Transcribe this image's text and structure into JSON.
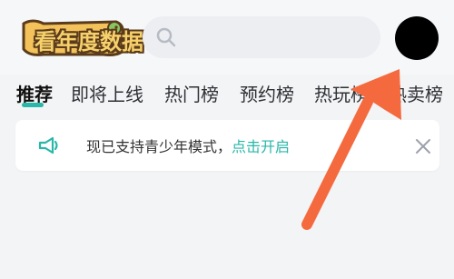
{
  "header": {
    "logo_text": "看年度数据",
    "search_icon": "search-icon",
    "avatar_icon": "avatar"
  },
  "tabs": [
    {
      "label": "推荐",
      "active": true
    },
    {
      "label": "即将上线",
      "active": false
    },
    {
      "label": "热门榜",
      "active": false
    },
    {
      "label": "预约榜",
      "active": false
    },
    {
      "label": "热玩榜",
      "active": false
    },
    {
      "label": "热卖榜",
      "active": false
    }
  ],
  "notice": {
    "text": "现已支持青少年模式，",
    "link": "点击开启",
    "icon": "megaphone-icon",
    "close_icon": "close-icon"
  },
  "colors": {
    "accent": "#28b7a8",
    "arrow": "#f46a3e"
  }
}
